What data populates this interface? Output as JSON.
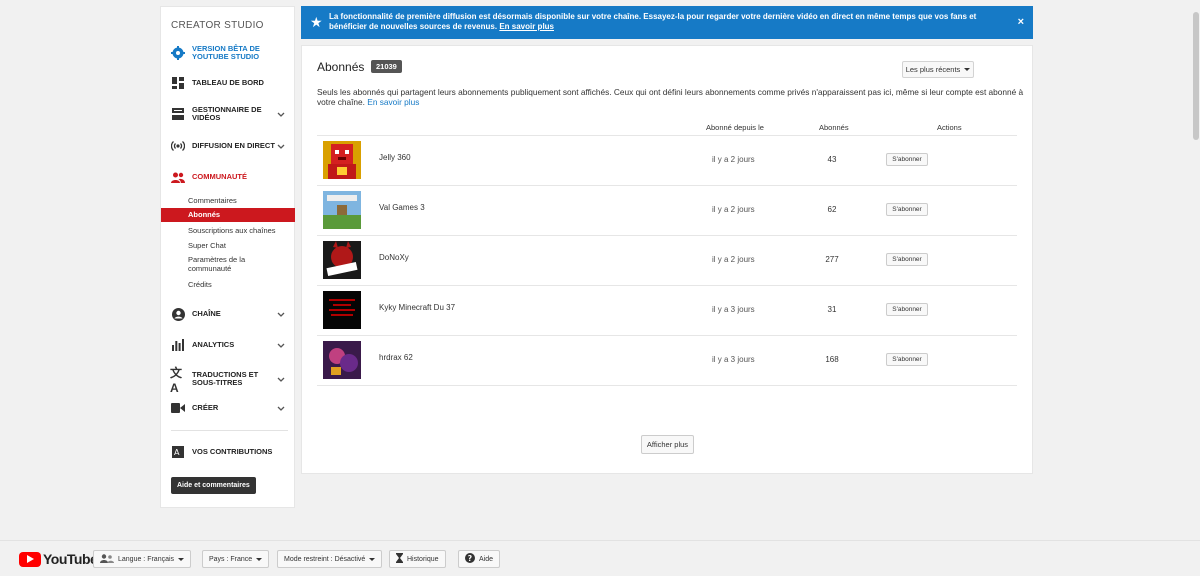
{
  "sidebar": {
    "title": "CREATOR STUDIO",
    "beta": "VERSION BÊTA DE YOUTUBE STUDIO",
    "dashboard": "TABLEAU DE BORD",
    "video_manager": "GESTIONNAIRE DE VIDÉOS",
    "live": "DIFFUSION EN DIRECT",
    "community": "COMMUNAUTÉ",
    "community_items": [
      "Commentaires",
      "Abonnés",
      "Souscriptions aux chaînes",
      "Super Chat",
      "Paramètres de la communauté",
      "Crédits"
    ],
    "channel": "CHAÎNE",
    "analytics": "ANALYTICS",
    "translations": "TRADUCTIONS ET SOUS-TITRES",
    "create": "CRÉER",
    "contributions": "VOS CONTRIBUTIONS",
    "help_button": "Aide et commentaires"
  },
  "notice": {
    "message": "La fonctionnalité de première diffusion est désormais disponible sur votre chaîne. Essayez-la pour regarder votre dernière vidéo en direct en même temps que vos fans et bénéficier de nouvelles sources de revenus.",
    "link": "En savoir plus",
    "close": "×"
  },
  "main": {
    "title": "Abonnés",
    "count": "21039",
    "sort_label": "Les plus récents",
    "description": "Seuls les abonnés qui partagent leurs abonnements publiquement sont affichés. Ceux qui ont défini leurs abonnements comme privés n'apparaissent pas ici, même si leur compte est abonné à votre chaîne.",
    "description_link": "En savoir plus",
    "columns": {
      "since": "Abonné depuis le",
      "subscribers": "Abonnés",
      "actions": "Actions"
    },
    "rows": [
      {
        "name": "Jelly 360",
        "since": "il y a 2 jours",
        "subscribers": "43",
        "action": "S'abonner"
      },
      {
        "name": "Val Games 3",
        "since": "il y a 2 jours",
        "subscribers": "62",
        "action": "S'abonner"
      },
      {
        "name": "DoNoXy",
        "since": "il y a 2 jours",
        "subscribers": "277",
        "action": "S'abonner"
      },
      {
        "name": "Kyky Minecraft Du 37",
        "since": "il y a 3 jours",
        "subscribers": "31",
        "action": "S'abonner"
      },
      {
        "name": "hrdrax 62",
        "since": "il y a 3 jours",
        "subscribers": "168",
        "action": "S'abonner"
      }
    ],
    "more_button": "Afficher plus"
  },
  "footer": {
    "logo": "YouTube",
    "language": "Langue : Français",
    "country": "Pays : France",
    "restricted": "Mode restreint : Désactivé",
    "history": "Historique",
    "help": "Aide"
  },
  "colors": {
    "accent_blue": "#167ac6",
    "accent_red": "#cc181e"
  }
}
